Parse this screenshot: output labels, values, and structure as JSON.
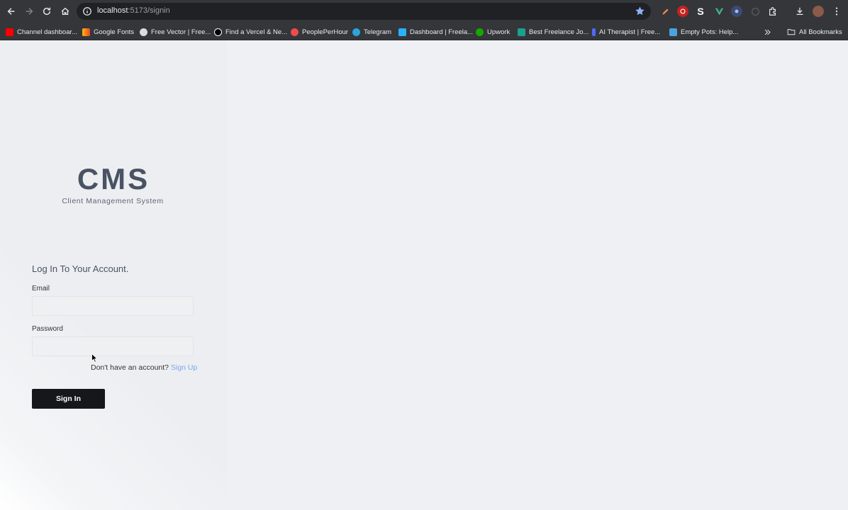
{
  "browser": {
    "url_host": "localhost",
    "url_path": ":5173/signin",
    "bookmarks": [
      {
        "label": "Channel dashboar...",
        "color": "#ff0000"
      },
      {
        "label": "Google Fonts",
        "color": "#fbbc04"
      },
      {
        "label": "Free Vector | Free...",
        "color": "#dadce0"
      },
      {
        "label": "Find a Vercel & Ne...",
        "color": "#000000"
      },
      {
        "label": "PeoplePerHour",
        "color": "#ef4b4b"
      },
      {
        "label": "Telegram",
        "color": "#2aa3df"
      },
      {
        "label": "Dashboard | Freela...",
        "color": "#29b2fe"
      },
      {
        "label": "Upwork",
        "color": "#14a800"
      },
      {
        "label": "Best Freelance Jo...",
        "color": "#1aa08f"
      },
      {
        "label": "AI Therapist | Free...",
        "color": "#4a6cf7"
      },
      {
        "label": "Empty Pots: Help...",
        "color": "#4aa3df"
      }
    ],
    "all_bookmarks": "All Bookmarks",
    "extension_letter": "S"
  },
  "brand": {
    "logo": "CMS",
    "tagline": "Client Management System"
  },
  "form": {
    "title": "Log In To Your Account.",
    "email_label": "Email",
    "email_value": "",
    "password_label": "Password",
    "password_value": "",
    "signup_prompt": "Don't have an account?",
    "signup_link": "Sign Up",
    "submit_label": "Sign In"
  },
  "colors": {
    "accent_link": "#7aa7e6",
    "button_bg": "#15171a",
    "logo_color": "#4a5363"
  }
}
